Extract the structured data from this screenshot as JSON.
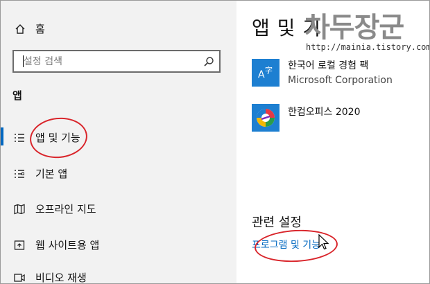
{
  "sidebar": {
    "home_label": "홈",
    "search_placeholder": "설정 검색",
    "section_title": "앱",
    "items": [
      {
        "label": "앱 및 기능",
        "icon": "apps-features-icon",
        "selected": true
      },
      {
        "label": "기본 앱",
        "icon": "default-apps-icon"
      },
      {
        "label": "오프라인 지도",
        "icon": "offline-maps-icon"
      },
      {
        "label": "웹 사이트용 앱",
        "icon": "apps-for-websites-icon"
      },
      {
        "label": "비디오 재생",
        "icon": "video-playback-icon"
      }
    ]
  },
  "main": {
    "title": "앱 및 기",
    "apps": [
      {
        "name": "한국어 로컬 경험 팩",
        "publisher": "Microsoft Corporation",
        "icon": "language-pack-icon"
      },
      {
        "name": "한컴오피스 2020",
        "publisher": "",
        "icon": "hancom-office-icon"
      }
    ],
    "related_title": "관련 설정",
    "related_link": "프로그램 및 기능"
  },
  "watermark": {
    "brand": "차두장군",
    "url": "http://mainia.tistory.com"
  },
  "colors": {
    "accent": "#0067c0",
    "annotation": "#d9252b",
    "sidebar_bg": "#f2f2f2"
  }
}
